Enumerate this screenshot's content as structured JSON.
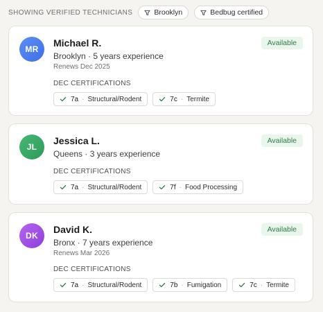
{
  "filters": {
    "heading": "SHOWING VERIFIED TECHNICIANS",
    "chips": [
      "Brooklyn",
      "Bedbug certified"
    ]
  },
  "colors": {
    "accent_available_bg": "#e9f6ec",
    "accent_available_text": "#2f7a45",
    "check": "#2f7a45"
  },
  "icons": {
    "filter": "filter-funnel-icon",
    "check": "check-icon"
  },
  "technicians": [
    {
      "initials": "MR",
      "name": "Michael R.",
      "meta": "Brooklyn · 5 years experience",
      "renews": "Renews Dec 2025",
      "status": "Available",
      "avatar_color": "#4f80f2",
      "certs_heading": "DEC CERTIFICATIONS",
      "certs": [
        {
          "code": "7a",
          "label": "Structural/Rodent"
        },
        {
          "code": "7c",
          "label": "Termite"
        }
      ]
    },
    {
      "initials": "JL",
      "name": "Jessica L.",
      "meta": "Queens · 3 years experience",
      "renews": "",
      "status": "Available",
      "avatar_color": "#3aa866",
      "certs_heading": "DEC CERTIFICATIONS",
      "certs": [
        {
          "code": "7a",
          "label": "Structural/Rodent"
        },
        {
          "code": "7f",
          "label": "Food Processing"
        }
      ]
    },
    {
      "initials": "DK",
      "name": "David K.",
      "meta": "Bronx · 7 years experience",
      "renews": "Renews Mar 2026",
      "status": "Available",
      "avatar_color": "#a24ee6",
      "certs_heading": "DEC CERTIFICATIONS",
      "certs": [
        {
          "code": "7a",
          "label": "Structural/Rodent"
        },
        {
          "code": "7b",
          "label": "Fumigation"
        },
        {
          "code": "7c",
          "label": "Termite"
        }
      ]
    }
  ]
}
